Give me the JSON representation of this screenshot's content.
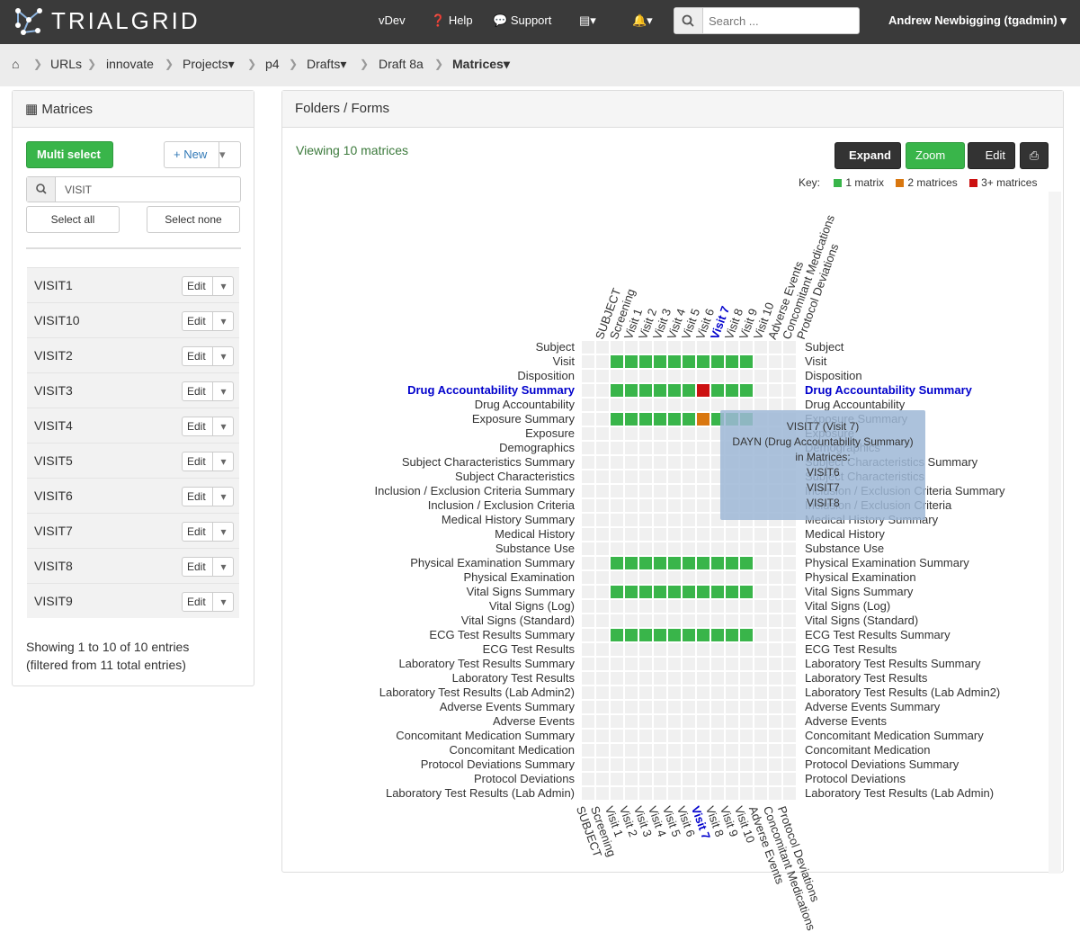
{
  "app": {
    "name": "TRIALGRID"
  },
  "topnav": {
    "version": "vDev",
    "help": "Help",
    "support": "Support",
    "search_placeholder": "Search ...",
    "user": "Andrew Newbigging (tgadmin)"
  },
  "breadcrumb": {
    "items": [
      "URLs",
      "innovate",
      "Projects",
      "p4",
      "Drafts",
      "Draft 8a",
      "Matrices"
    ]
  },
  "sidebar": {
    "title": "Matrices",
    "multi_select": "Multi select",
    "new": "New",
    "search_value": "VISIT",
    "select_all": "Select all",
    "select_none": "Select none",
    "edit_label": "Edit",
    "items": [
      "VISIT1",
      "VISIT10",
      "VISIT2",
      "VISIT3",
      "VISIT4",
      "VISIT5",
      "VISIT6",
      "VISIT7",
      "VISIT8",
      "VISIT9"
    ],
    "footer_line1": "Showing 1 to 10 of 10 entries",
    "footer_line2": "(filtered from 11 total entries)"
  },
  "main": {
    "title": "Folders / Forms",
    "viewing": "Viewing 10 matrices",
    "expand": "Expand",
    "zoom": "Zoom",
    "edit": "Edit",
    "key_label": "Key:",
    "key": [
      {
        "label": "1 matrix",
        "color": "#39b54a"
      },
      {
        "label": "2 matrices",
        "color": "#d9770f"
      },
      {
        "label": "3+ matrices",
        "color": "#cc1111"
      }
    ]
  },
  "grid": {
    "columns": [
      "SUBJECT",
      "Screening",
      "Visit 1",
      "Visit 2",
      "Visit 3",
      "Visit 4",
      "Visit 5",
      "Visit 6",
      "Visit 7",
      "Visit 8",
      "Visit 9",
      "Visit 10",
      "Adverse Events",
      "Concomitant Medications",
      "Protocol Deviations"
    ],
    "highlight_column": 8,
    "rows": [
      "Subject",
      "Visit",
      "Disposition",
      "Drug Accountability Summary",
      "Drug Accountability",
      "Exposure Summary",
      "Exposure",
      "Demographics",
      "Subject Characteristics Summary",
      "Subject Characteristics",
      "Inclusion / Exclusion Criteria Summary",
      "Inclusion / Exclusion Criteria",
      "Medical History Summary",
      "Medical History",
      "Substance Use",
      "Physical Examination Summary",
      "Physical Examination",
      "Vital Signs Summary",
      "Vital Signs (Log)",
      "Vital Signs (Standard)",
      "ECG Test Results Summary",
      "ECG Test Results",
      "Laboratory Test Results Summary",
      "Laboratory Test Results",
      "Laboratory Test Results (Lab Admin2)",
      "Adverse Events Summary",
      "Adverse Events",
      "Concomitant Medication Summary",
      "Concomitant Medication",
      "Protocol Deviations Summary",
      "Protocol Deviations",
      "Laboratory Test Results (Lab Admin)"
    ],
    "highlight_row": 3,
    "filled": [
      {
        "row": 1,
        "cols": [
          2,
          3,
          4,
          5,
          6,
          7,
          8,
          9,
          10,
          11
        ],
        "count": 1
      },
      {
        "row": 3,
        "cols": [
          2,
          3,
          4,
          5,
          6,
          7,
          9,
          10,
          11
        ],
        "count": 1
      },
      {
        "row": 3,
        "cols": [
          8
        ],
        "count": 3
      },
      {
        "row": 5,
        "cols": [
          2,
          3,
          4,
          5,
          6,
          7,
          9,
          10,
          11
        ],
        "count": 1
      },
      {
        "row": 5,
        "cols": [
          8
        ],
        "count": 2
      },
      {
        "row": 15,
        "cols": [
          2,
          3,
          4,
          5,
          6,
          7,
          8,
          9,
          10,
          11
        ],
        "count": 1
      },
      {
        "row": 17,
        "cols": [
          2,
          3,
          4,
          5,
          6,
          7,
          8,
          9,
          10,
          11
        ],
        "count": 1
      },
      {
        "row": 20,
        "cols": [
          2,
          3,
          4,
          5,
          6,
          7,
          8,
          9,
          10,
          11
        ],
        "count": 1
      }
    ]
  },
  "tooltip": {
    "line1": "VISIT7 (Visit 7)",
    "line2": "DAYN (Drug Accountability Summary)",
    "line3": "in Matrices:",
    "matrices": [
      "VISIT6",
      "VISIT7",
      "VISIT8"
    ]
  }
}
